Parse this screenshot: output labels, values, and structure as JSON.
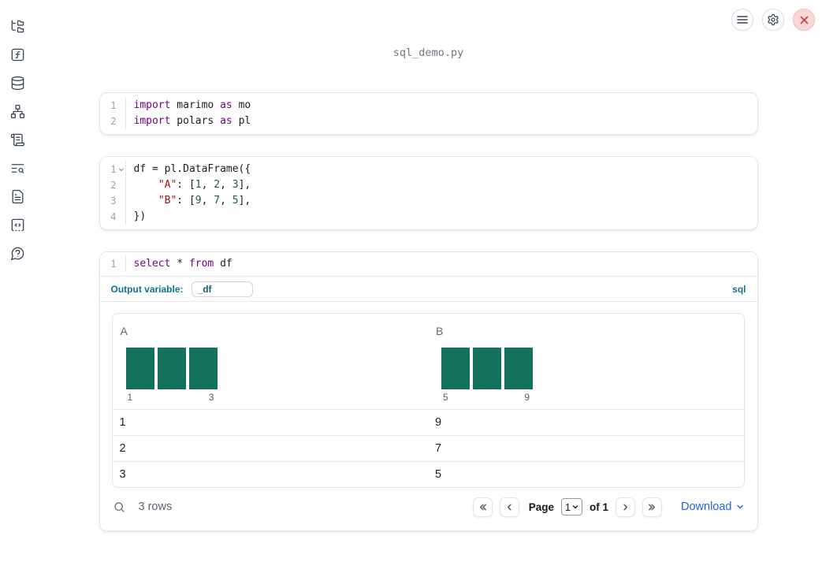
{
  "window": {
    "title": "sql_demo.py"
  },
  "topbar": {
    "buttons": [
      {
        "name": "menu",
        "icon": "hamburger-icon"
      },
      {
        "name": "settings",
        "icon": "gear-icon"
      },
      {
        "name": "shutdown",
        "icon": "close-icon"
      }
    ]
  },
  "sidebar": {
    "items": [
      {
        "name": "file-explorer",
        "icon": "folder-tree-icon"
      },
      {
        "name": "variables",
        "icon": "function-icon"
      },
      {
        "name": "datasources",
        "icon": "database-icon"
      },
      {
        "name": "dependencies",
        "icon": "network-graph-icon"
      },
      {
        "name": "logs",
        "icon": "scroll-icon"
      },
      {
        "name": "tracing",
        "icon": "list-search-icon"
      },
      {
        "name": "documentation",
        "icon": "document-icon"
      },
      {
        "name": "snippets",
        "icon": "code-snippet-icon"
      },
      {
        "name": "help",
        "icon": "help-bubble-icon"
      }
    ]
  },
  "cells": [
    {
      "lines": [
        {
          "num": "1",
          "tokens": [
            [
              "kw",
              "import"
            ],
            [
              "pl",
              " marimo "
            ],
            [
              "kw",
              "as"
            ],
            [
              "pl",
              " mo"
            ]
          ]
        },
        {
          "num": "2",
          "tokens": [
            [
              "kw",
              "import"
            ],
            [
              "pl",
              " polars "
            ],
            [
              "kw",
              "as"
            ],
            [
              "pl",
              " pl"
            ]
          ]
        }
      ]
    },
    {
      "lines": [
        {
          "num": "1",
          "fold": true,
          "tokens": [
            [
              "pl",
              "df = pl.DataFrame({"
            ]
          ]
        },
        {
          "num": "2",
          "tokens": [
            [
              "pl",
              "    "
            ],
            [
              "str",
              "\"A\""
            ],
            [
              "pl",
              ": ["
            ],
            [
              "num",
              "1"
            ],
            [
              "pl",
              ", "
            ],
            [
              "num",
              "2"
            ],
            [
              "pl",
              ", "
            ],
            [
              "num",
              "3"
            ],
            [
              "pl",
              "],"
            ]
          ]
        },
        {
          "num": "3",
          "tokens": [
            [
              "pl",
              "    "
            ],
            [
              "str",
              "\"B\""
            ],
            [
              "pl",
              ": ["
            ],
            [
              "num",
              "9"
            ],
            [
              "pl",
              ", "
            ],
            [
              "num",
              "7"
            ],
            [
              "pl",
              ", "
            ],
            [
              "num",
              "5"
            ],
            [
              "pl",
              "],"
            ]
          ]
        },
        {
          "num": "4",
          "tokens": [
            [
              "pl",
              "})"
            ]
          ]
        }
      ]
    },
    {
      "lines": [
        {
          "num": "1",
          "tokens": [
            [
              "kw",
              "select"
            ],
            [
              "pl",
              " * "
            ],
            [
              "kw",
              "from"
            ],
            [
              "pl",
              " df"
            ]
          ]
        }
      ],
      "output_variable_label": "Output variable:",
      "output_variable_value": "_df",
      "language_badge": "sql"
    }
  ],
  "table": {
    "columns": [
      {
        "label": "A",
        "histogram": {
          "type": "bar",
          "bins": [
            "1",
            "2",
            "3"
          ],
          "values": [
            1,
            1,
            1
          ],
          "x_min_label": "1",
          "x_max_label": "3"
        }
      },
      {
        "label": "B",
        "histogram": {
          "type": "bar",
          "bins": [
            "5",
            "7",
            "9"
          ],
          "values": [
            1,
            1,
            1
          ],
          "x_min_label": "5",
          "x_max_label": "9"
        }
      }
    ],
    "rows": [
      [
        "1",
        "9"
      ],
      [
        "2",
        "7"
      ],
      [
        "3",
        "5"
      ]
    ],
    "footer": {
      "row_count": "3 rows",
      "page_label": "Page",
      "page_value": "1",
      "of_label": "of 1",
      "download_label": "Download"
    }
  },
  "colors": {
    "keyword": "#770088",
    "string": "#aa1111",
    "number": "#116644",
    "histogram_bar": "#12705c",
    "sql_accent": "#0e7490",
    "link_blue": "#2563eb",
    "close_red": "#d23f3f"
  }
}
